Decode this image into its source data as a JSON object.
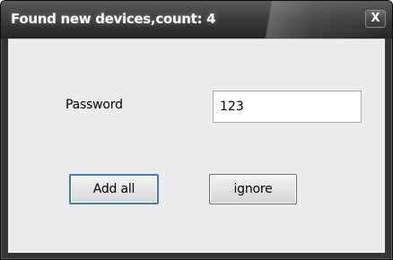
{
  "window": {
    "title": "Found new devices,count: 4",
    "close_label": "X"
  },
  "form": {
    "password_label": "Password",
    "password_value": "123"
  },
  "buttons": {
    "add_all": "Add all",
    "ignore": "ignore"
  },
  "colors": {
    "titlebar": "#3c3c3c",
    "client_background": "#ececec",
    "focus_border": "#3c7fb1"
  }
}
